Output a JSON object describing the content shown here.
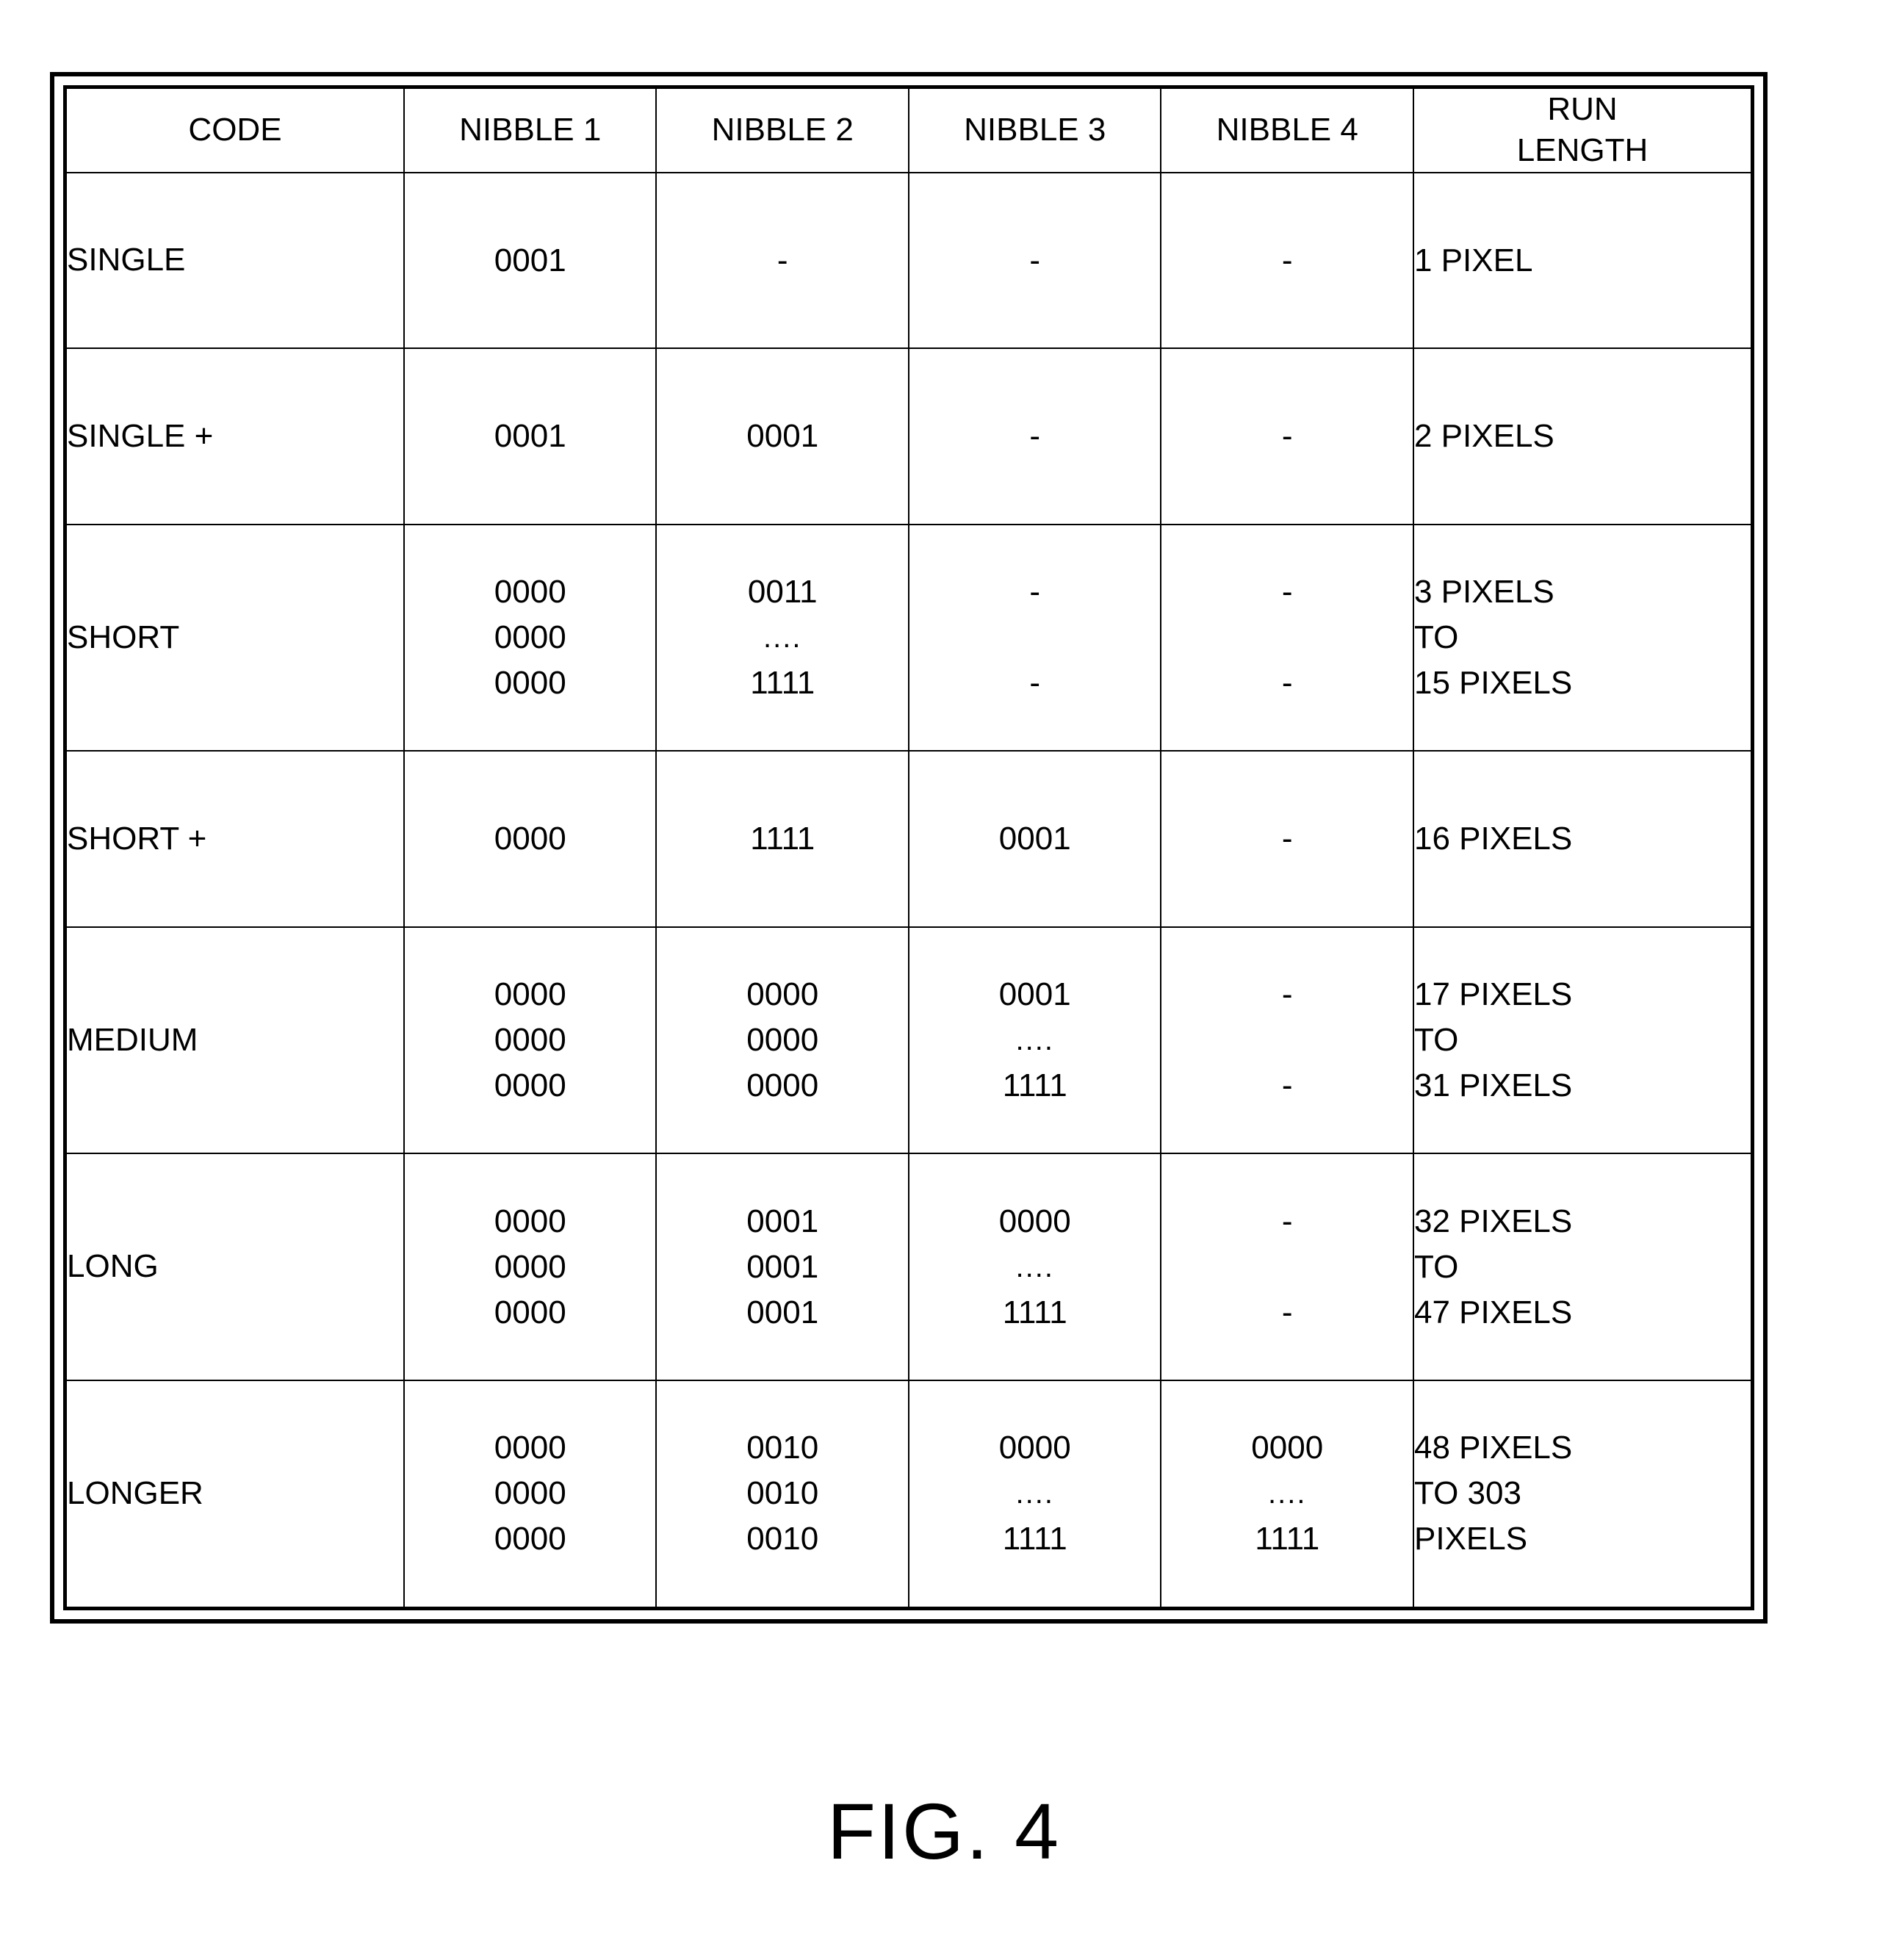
{
  "figure": {
    "caption": "FIG. 4"
  },
  "table": {
    "headers": [
      "CODE",
      "NIBBLE 1",
      "NIBBLE 2",
      "NIBBLE 3",
      "NIBBLE 4",
      "RUN\nLENGTH"
    ],
    "rows": [
      {
        "code": "SINGLE",
        "nibble1": [
          "0001"
        ],
        "nibble2": [
          "-"
        ],
        "nibble3": [
          "-"
        ],
        "nibble4": [
          "-"
        ],
        "run_length": [
          "1 PIXEL"
        ]
      },
      {
        "code": "SINGLE +",
        "nibble1": [
          "0001"
        ],
        "nibble2": [
          "0001"
        ],
        "nibble3": [
          "-"
        ],
        "nibble4": [
          "-"
        ],
        "run_length": [
          "2 PIXELS"
        ]
      },
      {
        "code": "SHORT",
        "nibble1": [
          "0000",
          "0000",
          "0000"
        ],
        "nibble2": [
          "0011",
          "....",
          "1111"
        ],
        "nibble3": [
          "-",
          "",
          "-"
        ],
        "nibble4": [
          "-",
          "",
          "-"
        ],
        "run_length": [
          "3 PIXELS",
          "TO",
          "15 PIXELS"
        ]
      },
      {
        "code": "SHORT +",
        "nibble1": [
          "0000"
        ],
        "nibble2": [
          "1111"
        ],
        "nibble3": [
          "0001"
        ],
        "nibble4": [
          "-"
        ],
        "run_length": [
          "16 PIXELS"
        ]
      },
      {
        "code": "MEDIUM",
        "nibble1": [
          "0000",
          "0000",
          "0000"
        ],
        "nibble2": [
          "0000",
          "0000",
          "0000"
        ],
        "nibble3": [
          "0001",
          "....",
          "1111"
        ],
        "nibble4": [
          "-",
          "",
          "-"
        ],
        "run_length": [
          "17 PIXELS",
          "TO",
          "31 PIXELS"
        ]
      },
      {
        "code": "LONG",
        "nibble1": [
          "0000",
          "0000",
          "0000"
        ],
        "nibble2": [
          "0001",
          "0001",
          "0001"
        ],
        "nibble3": [
          "0000",
          "....",
          "1111"
        ],
        "nibble4": [
          "-",
          "",
          "-"
        ],
        "run_length": [
          "32 PIXELS",
          "TO",
          "47 PIXELS"
        ]
      },
      {
        "code": "LONGER",
        "nibble1": [
          "0000",
          "0000",
          "0000"
        ],
        "nibble2": [
          "0010",
          "0010",
          "0010"
        ],
        "nibble3": [
          "0000",
          "....",
          "1111"
        ],
        "nibble4": [
          "0000",
          "....",
          "1111"
        ],
        "run_length": [
          "48 PIXELS",
          "TO 303",
          "PIXELS"
        ]
      }
    ]
  },
  "colors": {
    "ink": "#000000",
    "paper": "#ffffff"
  }
}
